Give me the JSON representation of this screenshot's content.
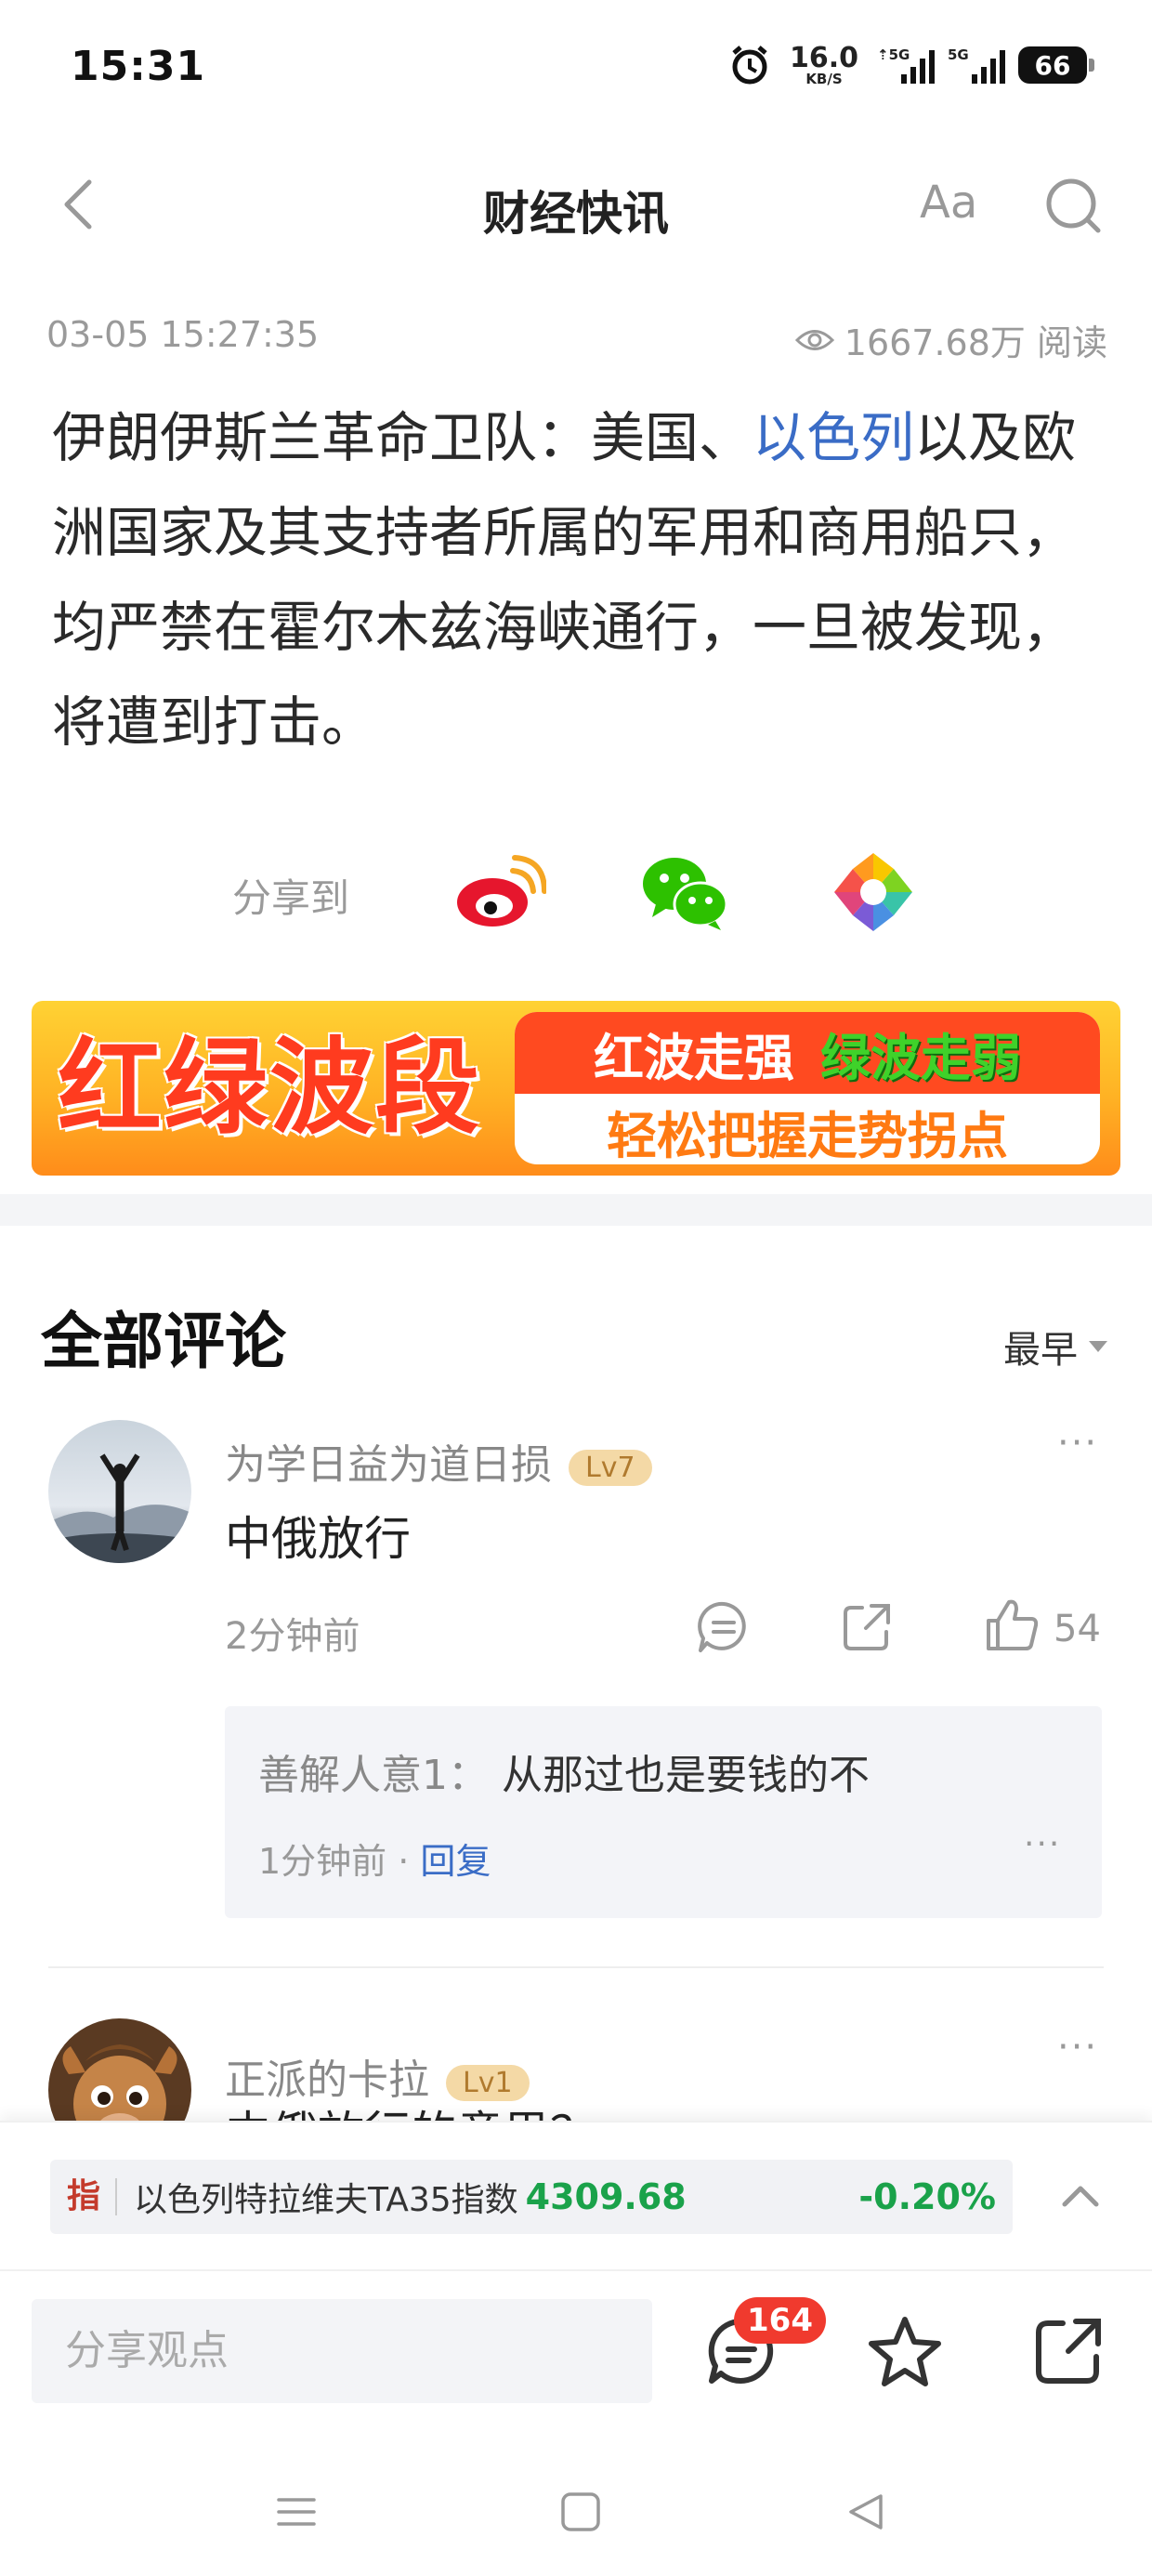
{
  "status_bar": {
    "time": "15:31",
    "speed_value": "16.0",
    "speed_unit": "KB/S",
    "signal1_tag": "⇡5G",
    "signal2_tag": "5G",
    "battery": "66"
  },
  "nav": {
    "title": "财经快讯",
    "font_label": "Aa"
  },
  "meta": {
    "datetime": "03-05 15:27:35",
    "views": "1667.68万 阅读"
  },
  "article": {
    "part1": "伊朗伊斯兰革命卫队：美国、",
    "link": "以色列",
    "part2": "以及欧洲国家及其支持者所属的军用和商用船只，均严禁在霍尔木兹海峡通行，一旦被发现，将遭到打击。"
  },
  "share": {
    "label": "分享到",
    "targets": [
      "weibo-icon",
      "wechat-icon",
      "moments-icon"
    ]
  },
  "banner": {
    "big_text": "红绿波段",
    "red_text": "红波走强",
    "green_text": "绿波走弱",
    "bottom_text": "轻松把握走势拐点"
  },
  "comments": {
    "title": "全部评论",
    "sort_label": "最早",
    "items": [
      {
        "name": "为学日益为道日损",
        "level": "Lv7",
        "text": "中俄放行",
        "time": "2分钟前",
        "likes": "54",
        "reply": {
          "author": "善解人意1：",
          "text": "从那过也是要钱的不",
          "time": "1分钟前 · ",
          "reply_label": "回复"
        }
      },
      {
        "name": "正派的卡拉",
        "level": "Lv1",
        "text": "中俄放行的意思？"
      }
    ],
    "more_label": "···"
  },
  "index": {
    "tag": "指",
    "name": "以色列特拉维夫TA35指数",
    "value": "4309.68",
    "change": "-0.20%",
    "color": "#1aa24a"
  },
  "bottom_bar": {
    "placeholder": "分享观点",
    "comment_count": "164"
  },
  "colors": {
    "link": "#3a6cc6",
    "badge": "#f03a2e"
  }
}
